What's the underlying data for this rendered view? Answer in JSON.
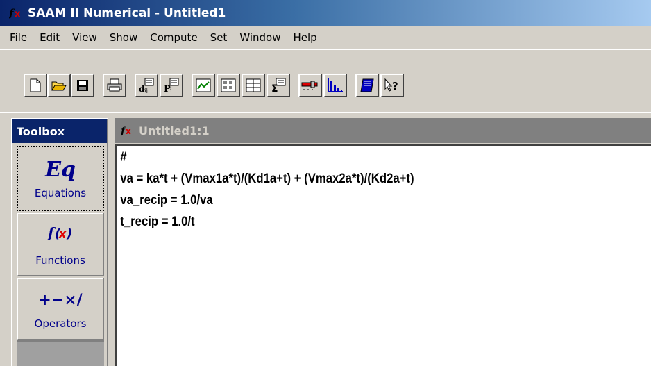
{
  "window": {
    "title": "SAAM II Numerical - Untitled1",
    "icon": "saam-f-icon"
  },
  "menu": [
    "File",
    "Edit",
    "View",
    "Show",
    "Compute",
    "Set",
    "Window",
    "Help"
  ],
  "toolbar": {
    "buttons": [
      "new-icon",
      "open-icon",
      "save-icon",
      "print-icon",
      "data-table-icon",
      "parameters-icon",
      "plot-icon",
      "table-view-icon",
      "columns-icon",
      "statistics-icon",
      "slider-icon",
      "histogram-icon",
      "notebook-icon",
      "context-help-icon"
    ]
  },
  "toolbox": {
    "title": "Toolbox",
    "tools": [
      {
        "glyph": "Eq",
        "label": "Equations"
      },
      {
        "glyph": "f(x)",
        "label": "Functions"
      },
      {
        "glyph": "+−×/",
        "label": "Operators"
      }
    ]
  },
  "document": {
    "title": "Untitled1:1",
    "lines": [
      "#",
      "va = ka*t + (Vmax1a*t)/(Kd1a+t) + (Vmax2a*t)/(Kd2a+t)",
      "va_recip = 1.0/va",
      "t_recip = 1.0/t"
    ]
  },
  "colors": {
    "title_active": "#0a246a",
    "title_inactive": "#808080",
    "face": "#d4d0c8",
    "tool_text": "#00008b"
  }
}
